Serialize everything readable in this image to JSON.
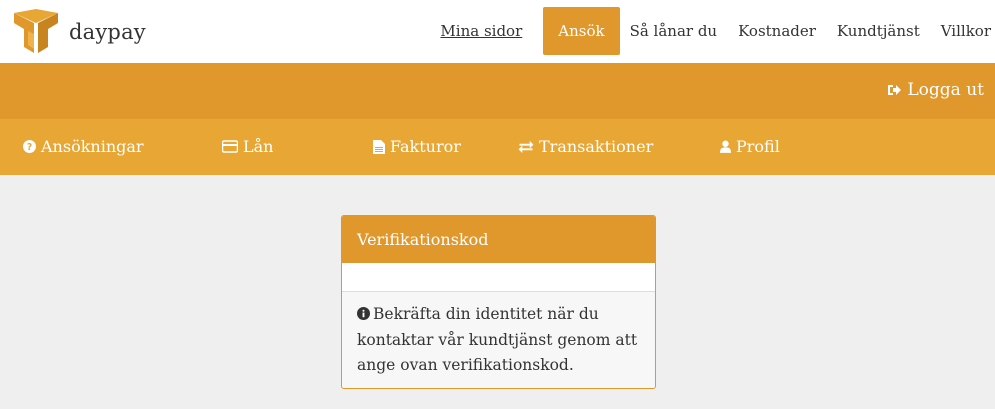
{
  "brand": {
    "name": "daypay",
    "logo_icon": "daypay-logo-icon",
    "accent": "#e0972b"
  },
  "topnav": {
    "items": [
      {
        "label": "Mina sidor"
      },
      {
        "label": "Ansök"
      },
      {
        "label": "Så lånar du"
      },
      {
        "label": "Kostnader"
      },
      {
        "label": "Kundtjänst"
      },
      {
        "label": "Villkor"
      }
    ]
  },
  "account": {
    "logout_label": "Logga ut",
    "logout_icon": "sign-out-icon"
  },
  "subnav": {
    "items": [
      {
        "label": "Ansökningar",
        "icon": "question-circle-icon"
      },
      {
        "label": "Lån",
        "icon": "credit-card-icon"
      },
      {
        "label": "Fakturor",
        "icon": "file-text-icon"
      },
      {
        "label": "Transaktioner",
        "icon": "exchange-icon"
      },
      {
        "label": "Profil",
        "icon": "user-icon"
      }
    ]
  },
  "verification": {
    "title": "Verifikationskod",
    "code": "",
    "info_icon": "info-circle-icon",
    "info_text": "Bekräfta din identitet när du kontaktar vår kundtjänst genom att ange ovan verifikationskod."
  },
  "colors": {
    "header_orange": "#e0972b",
    "subnav_orange": "#e8a634",
    "page_bg": "#efefef"
  }
}
